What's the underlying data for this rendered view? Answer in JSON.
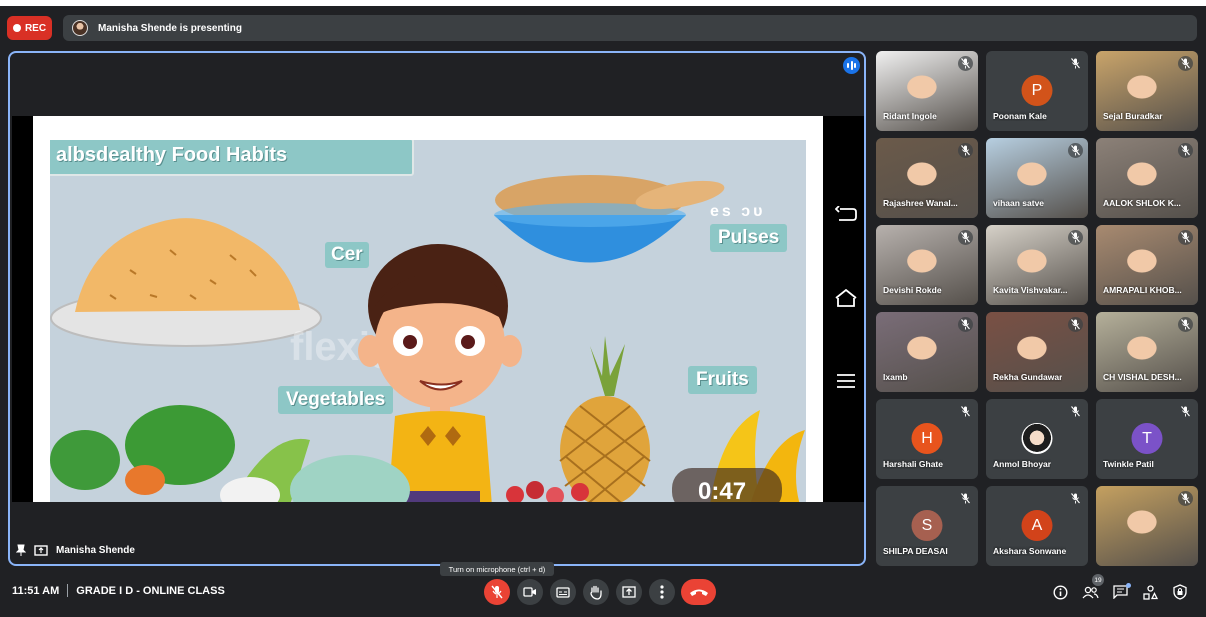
{
  "recording": {
    "label": "REC"
  },
  "presenting": {
    "text": "Manisha Shende is presenting"
  },
  "slide": {
    "title": "albsdealthy Food Habits",
    "labels": {
      "cereals": "Cer",
      "pulses_top": "es ɔᴜ",
      "pulses": "Pulses",
      "vegetables": "Vegetables",
      "fruits": "Fruits"
    },
    "watermark": "flexiguru",
    "timer": "0:47"
  },
  "stage": {
    "presenter_name": "Manisha Shende"
  },
  "participants": [
    {
      "name": "Ridant Ingole",
      "type": "video",
      "color": "#f0f0f0"
    },
    {
      "name": "Poonam Kale",
      "type": "avatar",
      "initial": "P",
      "color": "#d2531a"
    },
    {
      "name": "Sejal Buradkar",
      "type": "video",
      "color": "#c9a46a"
    },
    {
      "name": "Rajashree Wanal...",
      "type": "video",
      "color": "#6b5a4a"
    },
    {
      "name": "vihaan satve",
      "type": "video",
      "color": "#b7cfe1"
    },
    {
      "name": "AALOK SHLOK K...",
      "type": "video",
      "color": "#8c8178"
    },
    {
      "name": "Devishi Rokde",
      "type": "video",
      "color": "#b7b1ad"
    },
    {
      "name": "Kavita Vishvakar...",
      "type": "video",
      "color": "#d6d1c8"
    },
    {
      "name": "AMRAPALI KHOB...",
      "type": "video",
      "color": "#a88a70"
    },
    {
      "name": "Ixamb",
      "type": "video",
      "color": "#7a6d78"
    },
    {
      "name": "Rekha Gundawar",
      "type": "video",
      "color": "#7a5044"
    },
    {
      "name": "CH VISHAL DESH...",
      "type": "video",
      "color": "#b5b09a"
    },
    {
      "name": "Harshali Ghate",
      "type": "avatar",
      "initial": "H",
      "color": "#e8541d"
    },
    {
      "name": "Anmol Bhoyar",
      "type": "photo-avatar",
      "color": "#ffffff"
    },
    {
      "name": "Twinkle Patil",
      "type": "avatar",
      "initial": "T",
      "color": "#7b52c8"
    },
    {
      "name": "SHILPA DEASAI",
      "type": "avatar",
      "initial": "S",
      "color": "#a66050"
    },
    {
      "name": "Akshara Sonwane",
      "type": "avatar",
      "initial": "A",
      "color": "#d2431a"
    },
    {
      "name": "",
      "type": "video",
      "color": "#c4a060"
    }
  ],
  "meeting": {
    "time": "11:51 AM",
    "title": "GRADE I D - ONLINE CLASS"
  },
  "tooltip": "Turn on microphone (ctrl + d)",
  "controls": [
    "mic-off-icon",
    "camera-icon",
    "captions-icon",
    "raise-hand-icon",
    "present-icon",
    "more-icon",
    "hang-up-icon"
  ],
  "right_controls": {
    "people_count": "19"
  }
}
